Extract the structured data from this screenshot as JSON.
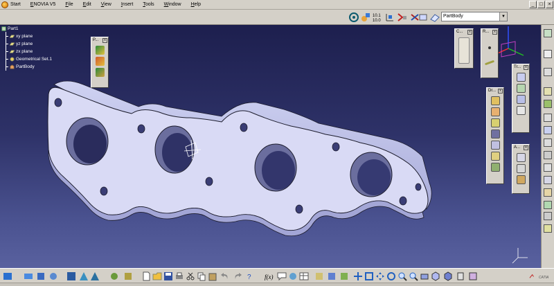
{
  "menubar": {
    "start": "Start",
    "items": [
      "ENOVIA V5",
      "File",
      "Edit",
      "View",
      "Insert",
      "Tools",
      "Window",
      "Help"
    ]
  },
  "toolbar": {
    "body_select": "PartBody",
    "select_arrow": "▼"
  },
  "tree": {
    "root": "Part1",
    "items": [
      "xy plane",
      "yz plane",
      "zx plane",
      "Geometrical Set.1",
      "PartBody"
    ]
  },
  "palettes": [
    {
      "id": "p1",
      "title": "P..."
    },
    {
      "id": "c",
      "title": "C..."
    },
    {
      "id": "r",
      "title": "R..."
    },
    {
      "id": "tr",
      "title": "Tr..."
    },
    {
      "id": "dr",
      "title": "Dr..."
    },
    {
      "id": "a",
      "title": "A..."
    }
  ],
  "window_controls": [
    "_",
    "□",
    "×"
  ],
  "brand": "CATIA",
  "colors": {
    "part_face": "#d9daf5",
    "part_side": "#b9bce6",
    "part_edge": "#1c1c2c",
    "viewport_top": "#1d1f4e",
    "viewport_bottom": "#59619f"
  }
}
